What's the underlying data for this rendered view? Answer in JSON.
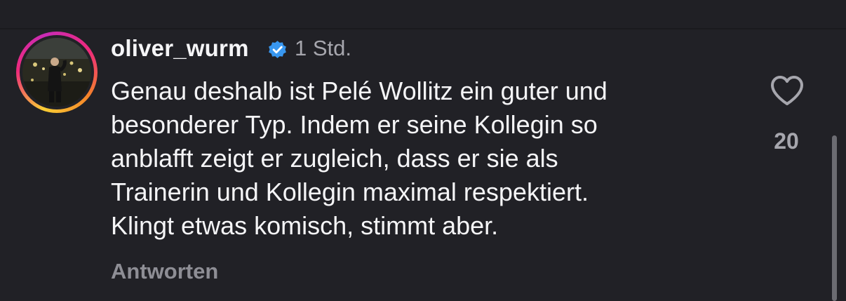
{
  "comment": {
    "username": "oliver_wurm",
    "timestamp": "1 Std.",
    "text_lines": [
      "Genau deshalb ist Pelé Wollitz ein guter und",
      "besonderer Typ. Indem er seine Kollegin so",
      "anblafft zeigt er zugleich, dass er sie als",
      "Trainerin und Kollegin maximal respektiert.",
      "Klingt etwas komisch, stimmt aber."
    ],
    "reply_label": "Antworten",
    "like_count": "20",
    "verified": true
  },
  "icons": {
    "verified": "verified-badge-icon",
    "like": "heart-outline-icon"
  },
  "colors": {
    "background": "#212126",
    "verified_blue": "#3897f0",
    "text_primary": "#f5f5f7",
    "text_secondary": "#a6a6ad",
    "story_ring": [
      "#f9ce34",
      "#ee2a7b",
      "#c92bb7"
    ]
  }
}
